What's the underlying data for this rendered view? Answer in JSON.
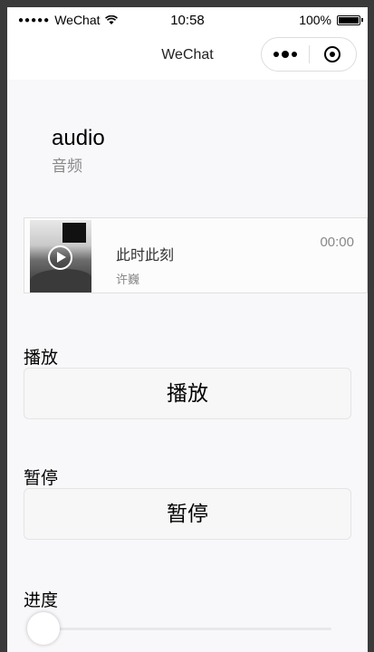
{
  "status_bar": {
    "carrier": "WeChat",
    "time": "10:58",
    "battery": "100%"
  },
  "nav": {
    "title": "WeChat"
  },
  "page": {
    "title": "audio",
    "subtitle": "音频"
  },
  "audio_player": {
    "name": "此时此刻",
    "author": "许巍",
    "time": "00:00"
  },
  "sections": {
    "play_label": "播放",
    "play_button": "播放",
    "pause_label": "暂停",
    "pause_button": "暂停",
    "progress_label": "进度"
  },
  "progress": {
    "value": 0
  },
  "icons": {
    "signal": "signal-dots-icon",
    "wifi": "wifi-icon",
    "battery": "battery-icon",
    "more": "more-dots-icon",
    "close": "close-circle-icon",
    "play": "play-icon"
  }
}
